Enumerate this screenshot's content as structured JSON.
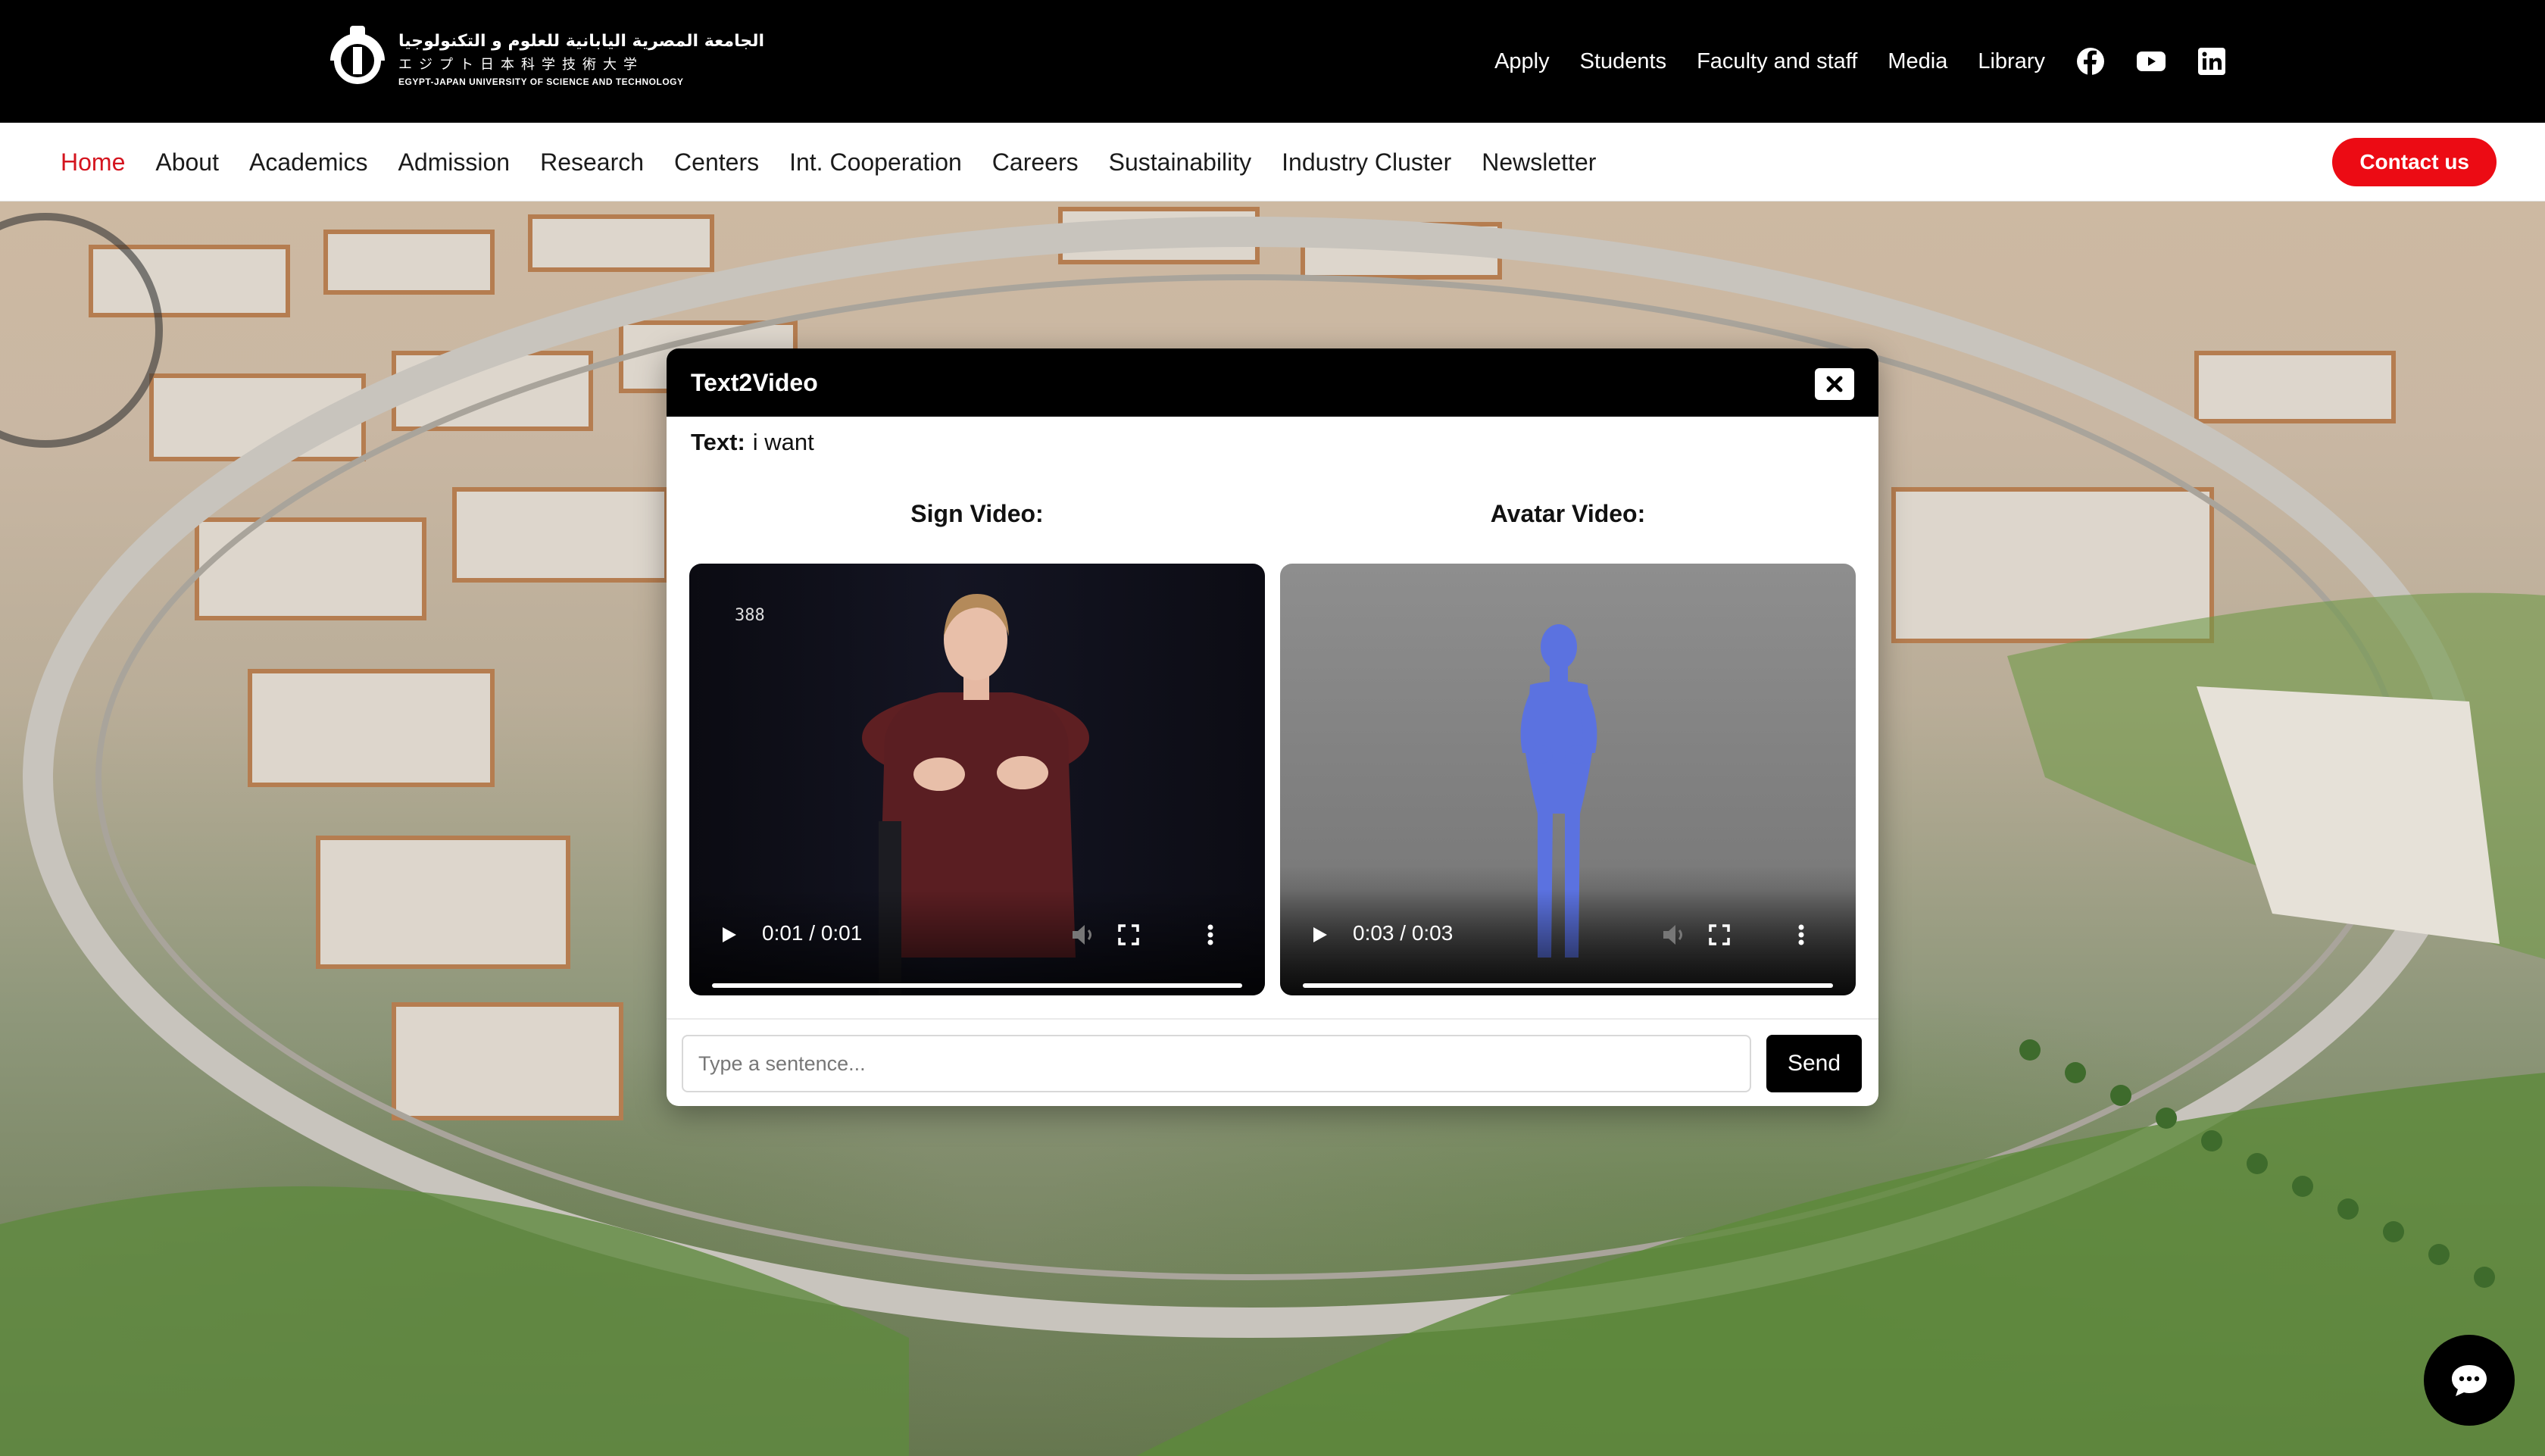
{
  "brand": {
    "arabic": "الجامعة المصرية اليابانية للعلوم و التكنولوجيا",
    "japanese": "エジプト日本科学技術大学",
    "english": "EGYPT-JAPAN UNIVERSITY OF SCIENCE AND TECHNOLOGY"
  },
  "top_links": [
    "Apply",
    "Students",
    "Faculty and staff",
    "Media",
    "Library"
  ],
  "social_icons": [
    "facebook-icon",
    "youtube-icon",
    "linkedin-icon"
  ],
  "nav": {
    "items": [
      "Home",
      "About",
      "Academics",
      "Admission",
      "Research",
      "Centers",
      "Int. Cooperation",
      "Careers",
      "Sustainability",
      "Industry Cluster",
      "Newsletter"
    ],
    "active": "Home",
    "contact_label": "Contact us"
  },
  "colors": {
    "accent_red": "#ec0b14",
    "active_nav": "#d4141e",
    "modal_header": "#000000"
  },
  "modal": {
    "title": "Text2Video",
    "close_icon": "close-icon",
    "text_label": "Text:",
    "text_value": "i want",
    "sign_video": {
      "title": "Sign Video:",
      "frame_counter": "388",
      "time": "0:01 / 0:01",
      "progress": 1.0
    },
    "avatar_video": {
      "title": "Avatar Video:",
      "time": "0:03 / 0:03",
      "progress": 1.0
    },
    "input_placeholder": "Type a sentence...",
    "input_value": "",
    "send_label": "Send"
  },
  "chat_icon": "chat-bubble-icon"
}
